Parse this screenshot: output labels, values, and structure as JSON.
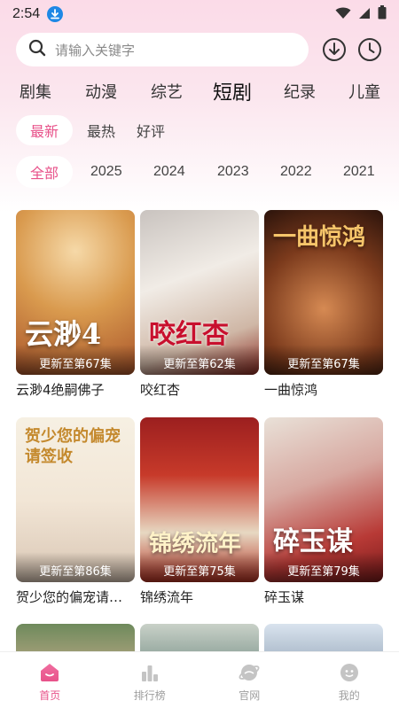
{
  "status": {
    "time": "2:54",
    "download_icon": "download-badge-icon",
    "wifi_icon": "wifi-icon",
    "signal_icon": "signal-icon",
    "battery_icon": "battery-icon"
  },
  "search": {
    "placeholder": "请输入关键字",
    "icons": [
      "search-icon",
      "download-icon",
      "history-icon"
    ]
  },
  "categories": {
    "items": [
      "剧集",
      "动漫",
      "综艺",
      "短剧",
      "纪录",
      "儿童"
    ],
    "active": "短剧"
  },
  "sort": {
    "items": [
      "最新",
      "最热",
      "好评"
    ],
    "active": "最新"
  },
  "years": {
    "items": [
      "全部",
      "2025",
      "2024",
      "2023",
      "2022",
      "2021"
    ],
    "active": "全部"
  },
  "cards": [
    {
      "title": "云渺4绝嗣佛子",
      "update": "更新至第67集",
      "art_text": "云渺4"
    },
    {
      "title": "咬红杏",
      "update": "更新至第62集",
      "art_text": "咬红杏"
    },
    {
      "title": "一曲惊鸿",
      "update": "更新至第67集",
      "art_text": "一曲惊鸿"
    },
    {
      "title": "贺少您的偏宠请签收",
      "update": "更新至第86集",
      "art_text": "贺少您的偏宠请签收"
    },
    {
      "title": "锦绣流年",
      "update": "更新至第75集",
      "art_text": "锦绣流年"
    },
    {
      "title": "碎玉谋",
      "update": "更新至第79集",
      "art_text": "碎玉谋"
    }
  ],
  "colors": {
    "accent": "#e8528a",
    "header_gradient_top": "#fbdbe8"
  },
  "bottom_nav": {
    "items": [
      {
        "label": "首页",
        "icon": "home-icon"
      },
      {
        "label": "排行榜",
        "icon": "ranking-icon"
      },
      {
        "label": "官网",
        "icon": "website-icon"
      },
      {
        "label": "我的",
        "icon": "profile-icon"
      }
    ],
    "active": "首页"
  }
}
